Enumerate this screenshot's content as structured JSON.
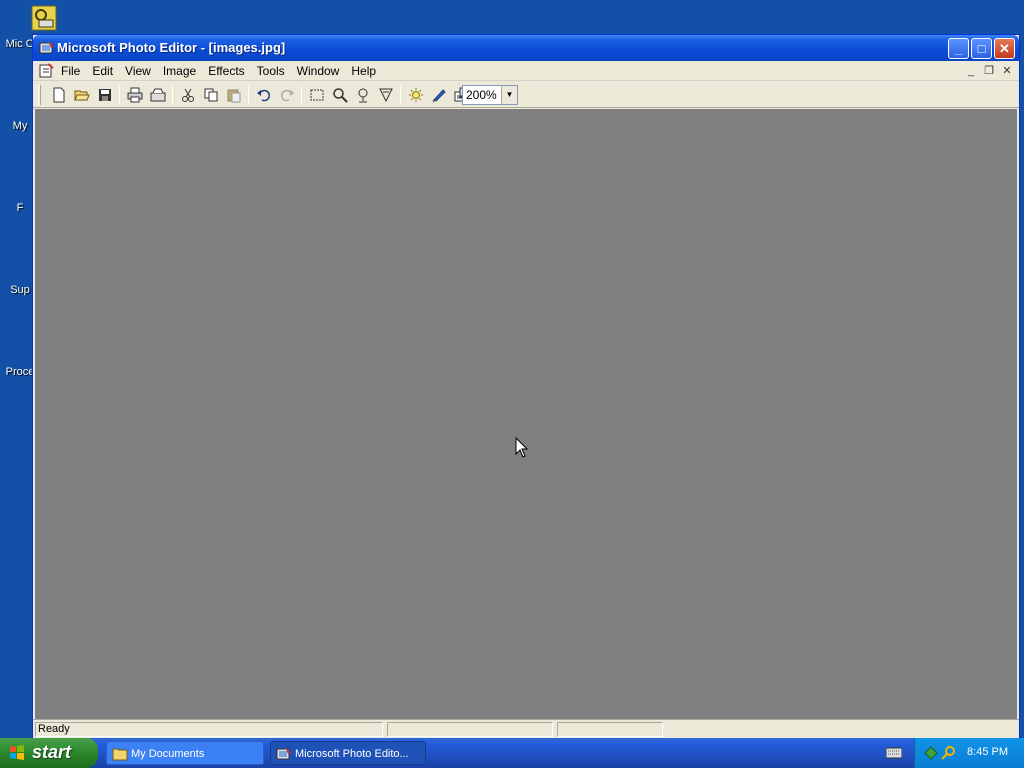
{
  "window": {
    "title": "Microsoft Photo Editor - [images.jpg]"
  },
  "menu": {
    "items": [
      "File",
      "Edit",
      "View",
      "Image",
      "Effects",
      "Tools",
      "Window",
      "Help"
    ]
  },
  "toolbar": {
    "tools": [
      "new-icon",
      "open-icon",
      "save-icon",
      "print-icon",
      "scan-icon",
      "cut-icon",
      "copy-icon",
      "paste-icon",
      "undo-icon",
      "redo-icon",
      "select-icon",
      "zoom-icon",
      "smudge-icon",
      "transparent-icon",
      "sharpen-icon",
      "retouch-icon",
      "properties-icon"
    ],
    "zoom_value": "200%"
  },
  "status": {
    "text": "Ready"
  },
  "desktop": {
    "icons": [
      {
        "label": "Mic O",
        "icon": "outlook-icon"
      },
      {
        "label": "My",
        "icon": "my-documents-icon"
      },
      {
        "label": "F",
        "icon": "folder-icon"
      },
      {
        "label": "Sup",
        "icon": "support-icon"
      },
      {
        "label": "Proce",
        "icon": "process-icon"
      }
    ]
  },
  "taskbar": {
    "start_label": "start",
    "tasks": [
      {
        "label": "My Documents",
        "icon": "folder-icon",
        "active": false
      },
      {
        "label": "Microsoft Photo Edito...",
        "icon": "photo-editor-icon",
        "active": true
      }
    ],
    "clock": "8:45 PM"
  },
  "colors": {
    "desktop": "#1351a8",
    "workspace": "#808080",
    "titlebar": "#0a4cd6",
    "start": "#2f8c2f"
  }
}
